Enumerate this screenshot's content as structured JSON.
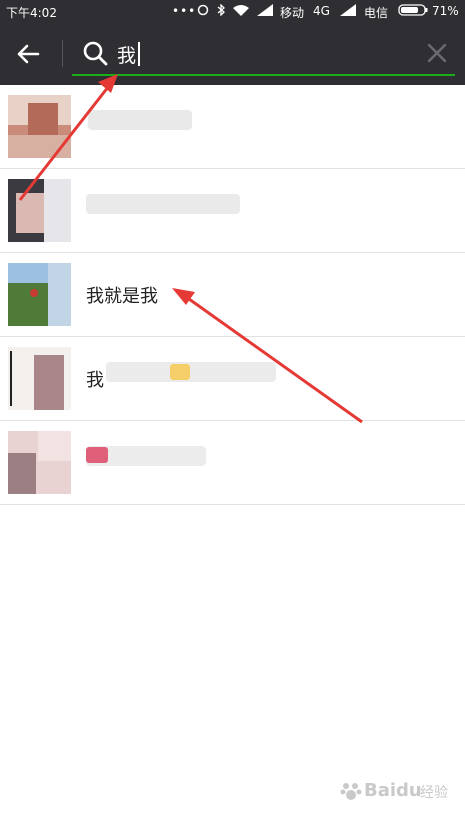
{
  "status_bar": {
    "time": "下午4:02",
    "carrier1": "移动",
    "network": "4G",
    "carrier2": "电信",
    "battery": "71%"
  },
  "search": {
    "query": "我"
  },
  "results": [
    {
      "name": ""
    },
    {
      "name": ""
    },
    {
      "name": "我就是我"
    },
    {
      "name": "我"
    },
    {
      "name": ""
    }
  ],
  "watermark": {
    "brand": "Baidu",
    "suffix": "经验"
  },
  "colors": {
    "bar_background": "#2e2e33",
    "accent_green": "#1aad19",
    "annotation_red": "#e53935"
  }
}
